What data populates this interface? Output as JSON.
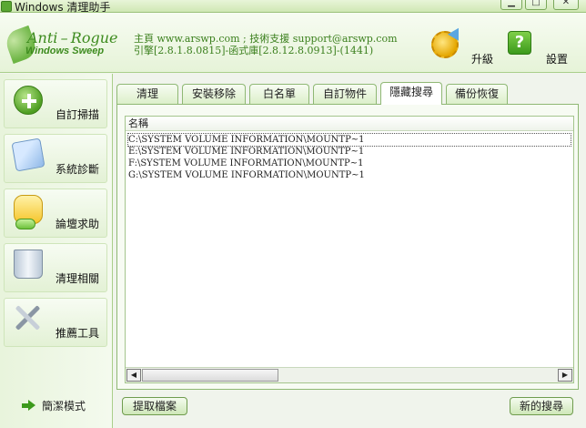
{
  "window": {
    "title": "Windows 清理助手"
  },
  "header": {
    "logo_line1": "Anti – Rogue",
    "logo_line2": "Windows Sweep",
    "info_line1": "主頁 www.arswp.com ; 技術支援 support@arswp.com",
    "info_line2": "引擎[2.8.1.8.0815]-函式庫[2.8.12.8.0913]-(1441)",
    "upgrade_label": "升級",
    "settings_label": "設置",
    "settings_icon_glyph": "?"
  },
  "sidebar": {
    "items": [
      {
        "label": "自訂掃描",
        "icon": "plus-icon"
      },
      {
        "label": "系統診斷",
        "icon": "diagnose-icon"
      },
      {
        "label": "論壇求助",
        "icon": "forum-icon"
      },
      {
        "label": "清理相關",
        "icon": "recycle-bin-icon"
      },
      {
        "label": "推薦工具",
        "icon": "tools-icon"
      }
    ],
    "simple_mode_label": "簡潔模式"
  },
  "tabs": [
    {
      "label": "清理"
    },
    {
      "label": "安裝移除"
    },
    {
      "label": "白名單"
    },
    {
      "label": "自訂物件"
    },
    {
      "label": "隱藏搜尋",
      "active": true
    },
    {
      "label": "備份恢復"
    }
  ],
  "list": {
    "column_header": "名稱",
    "rows": [
      "C:\\SYSTEM VOLUME INFORMATION\\MOUNTP~1",
      "E:\\SYSTEM VOLUME INFORMATION\\MOUNTP~1",
      "F:\\SYSTEM VOLUME INFORMATION\\MOUNTP~1",
      "G:\\SYSTEM VOLUME INFORMATION\\MOUNTP~1"
    ]
  },
  "buttons": {
    "extract_label": "提取檔案",
    "search_label": "新的搜尋"
  },
  "scrollbar": {
    "left_arrow": "◀",
    "right_arrow": "▶"
  }
}
